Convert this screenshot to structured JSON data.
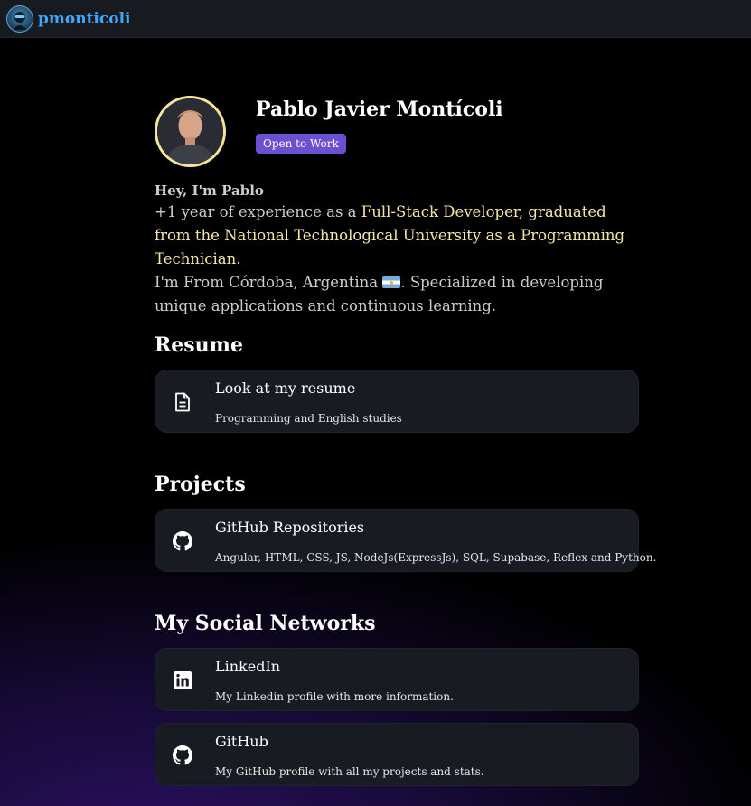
{
  "navbar": {
    "brand": "pmonticoli",
    "logo_icon": "developer-avatar-logo"
  },
  "profile": {
    "name": "Pablo Javier Montícoli",
    "badge": "Open to Work",
    "avatar_icon": "profile-photo"
  },
  "intro": {
    "greeting": "Hey, I'm Pablo",
    "bio_part1": "+1 year of experience as a ",
    "bio_highlight": "Full-Stack Developer, graduated from the National Technological University as a Programming Technician.",
    "bio_part2": "I'm From Córdoba, Argentina",
    "bio_part3": ". Specialized in developing unique applications and continuous learning.",
    "flag_icon": "argentina-flag-icon"
  },
  "sections": {
    "resume": {
      "title": "Resume",
      "card": {
        "title": "Look at my resume",
        "subtitle": "Programming and English studies",
        "icon": "document-icon"
      }
    },
    "projects": {
      "title": "Projects",
      "card": {
        "title": "GitHub Repositories",
        "subtitle": "Angular, HTML, CSS, JS, NodeJs(ExpressJs), SQL, Supabase, Reflex and Python.",
        "icon": "github-icon"
      }
    },
    "social": {
      "title": "My Social Networks",
      "cards": [
        {
          "title": "LinkedIn",
          "subtitle": "My Linkedin profile with more information.",
          "icon": "linkedin-icon"
        },
        {
          "title": "GitHub",
          "subtitle": "My GitHub profile with all my projects and stats.",
          "icon": "github-icon"
        }
      ]
    }
  },
  "colors": {
    "accent_brand": "#3ea6ff",
    "badge": "#6d4fd1",
    "highlight_text": "#f6e6a6",
    "avatar_border": "#f5e49a",
    "card_bg": "#181c22"
  }
}
